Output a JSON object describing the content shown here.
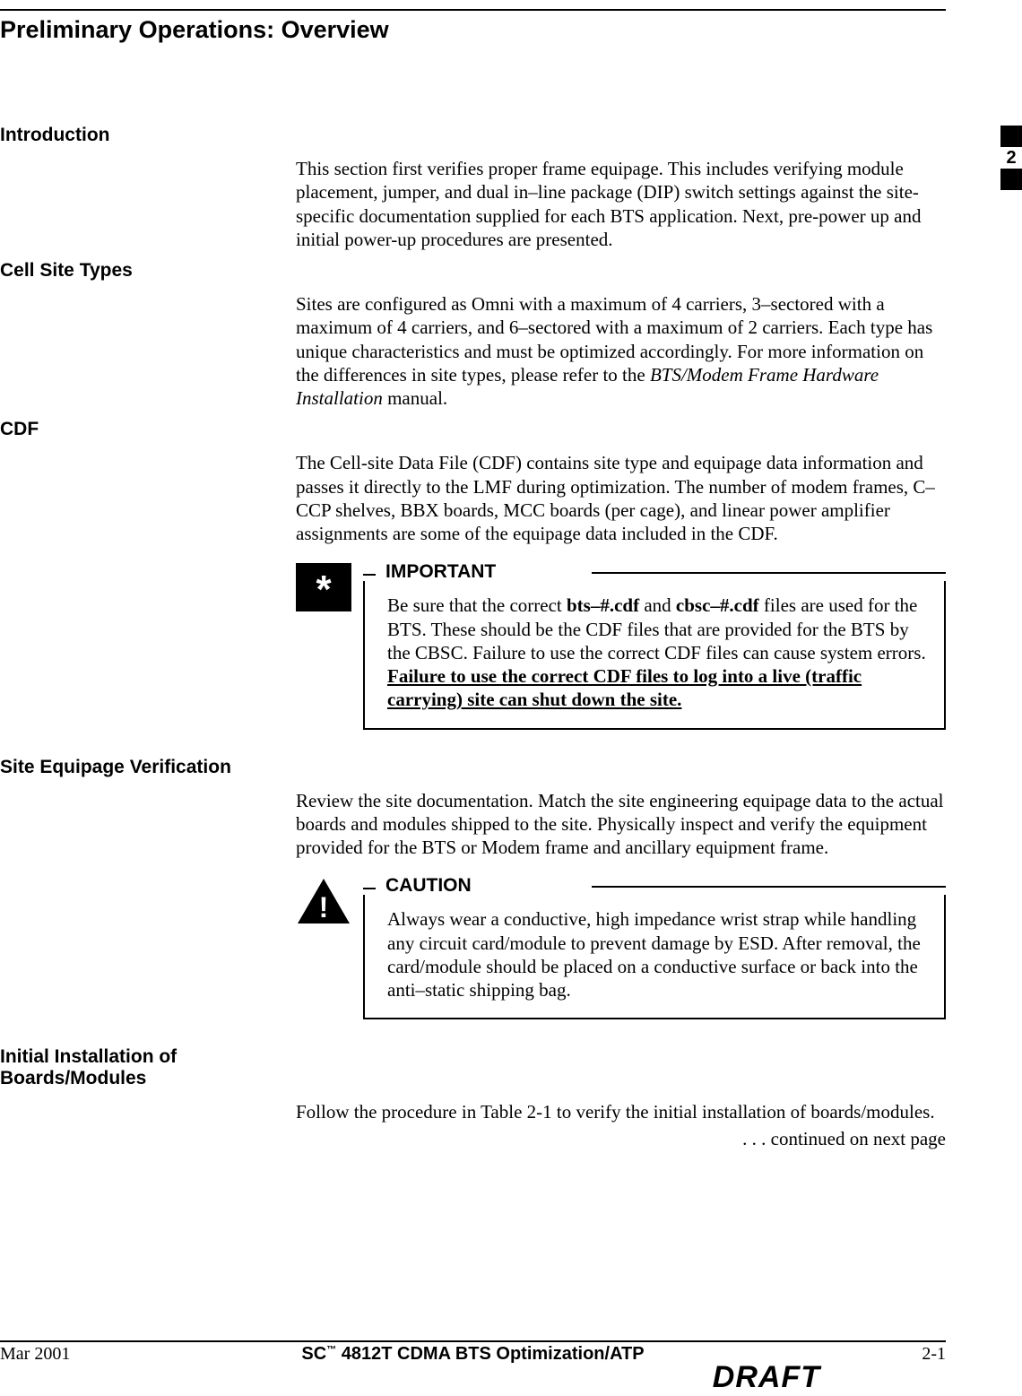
{
  "page_title": "Preliminary Operations: Overview",
  "tab": {
    "number": "2"
  },
  "sections": {
    "intro": {
      "heading": "Introduction",
      "body": "This section first verifies proper frame equipage. This includes verifying module placement, jumper, and dual in–line package (DIP) switch settings against the site-specific documentation supplied for each BTS application. Next, pre-power up and initial power-up procedures are presented."
    },
    "celltypes": {
      "heading": "Cell Site Types",
      "body_pre": "Sites are configured as Omni with a maximum of 4 carriers, 3–sectored with a maximum of 4 carriers, and 6–sectored with a maximum of 2 carriers. Each type has unique characteristics and must be optimized accordingly. For more information on the differences in site types, please refer to the ",
      "body_em": "BTS/Modem Frame Hardware Installation",
      "body_post": " manual."
    },
    "cdf": {
      "heading": "CDF",
      "body": "The Cell-site Data File (CDF) contains site type and equipage data information and passes it directly to the LMF during optimization. The number of modem frames, C–CCP shelves, BBX boards, MCC boards (per cage), and linear power amplifier assignments are some of the equipage data included in the CDF.",
      "callout": {
        "title": "IMPORTANT",
        "pre": "Be sure that the correct ",
        "b1": "bts–#.cdf",
        "mid1": " and ",
        "b2": "cbsc–#.cdf",
        "mid2": " files are used for the BTS. These should be the CDF files that are provided for the BTS by the CBSC. Failure to use the correct CDF files can cause system errors. ",
        "warn": "Failure to use the correct CDF files to log into a live (traffic carrying) site can shut down the site."
      }
    },
    "equipage": {
      "heading": "Site Equipage Verification",
      "body": "Review the site documentation. Match the site engineering equipage data to the actual boards and modules shipped to the site. Physically inspect and verify the equipment provided for the BTS or Modem frame and ancillary equipment frame.",
      "callout": {
        "title": "CAUTION",
        "body": "Always wear a conductive, high impedance wrist strap while handling any circuit card/module to prevent damage by ESD. After removal, the card/module should be placed on a conductive surface or back into the anti–static shipping bag."
      }
    },
    "install": {
      "heading": "Initial Installation of Boards/Modules",
      "body": "Follow the procedure in Table 2-1 to verify the initial installation of boards/modules."
    }
  },
  "continued": " . . . continued on next page",
  "footer": {
    "left": "Mar 2001",
    "center_pre": "SC",
    "center_tm": "™",
    "center_post": " 4812T CDMA BTS Optimization/ATP",
    "right": "2-1",
    "draft": "DRAFT"
  }
}
